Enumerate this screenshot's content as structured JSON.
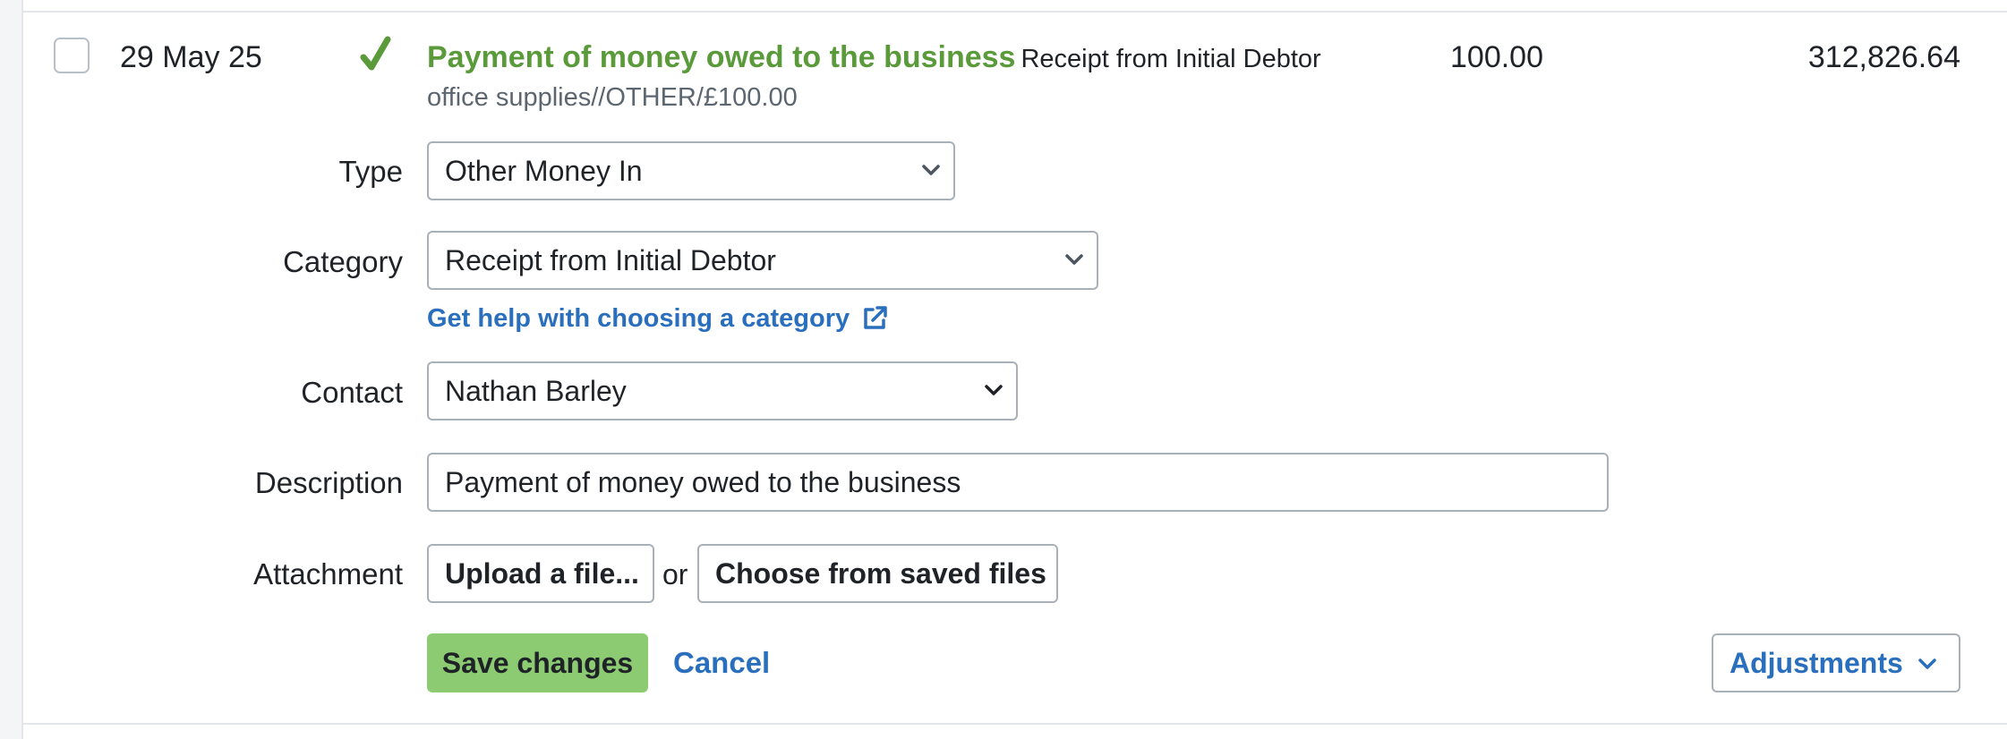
{
  "transaction": {
    "date": "29 May 25",
    "title": "Payment of money owed to the business",
    "category_summary": "Receipt from Initial Debtor",
    "reference": "office supplies//OTHER/£100.00",
    "amount": "100.00",
    "balance": "312,826.64"
  },
  "form": {
    "type_label": "Type",
    "type_value": "Other Money In",
    "category_label": "Category",
    "category_value": "Receipt from Initial Debtor",
    "help_link": "Get help with choosing a category",
    "contact_label": "Contact",
    "contact_value": "Nathan Barley",
    "description_label": "Description",
    "description_value": "Payment of money owed to the business",
    "attachment_label": "Attachment",
    "upload_button": "Upload a file...",
    "or_text": "or",
    "saved_files_button": "Choose from saved files"
  },
  "actions": {
    "save": "Save changes",
    "cancel": "Cancel",
    "adjustments": "Adjustments"
  },
  "colors": {
    "accent_green": "#5a9a3b",
    "button_green": "#8dcb73",
    "link_blue": "#2a6fbd"
  },
  "icons": {
    "status": "checkmark-icon",
    "external": "external-link-icon",
    "dropdown": "chevron-down-icon"
  }
}
